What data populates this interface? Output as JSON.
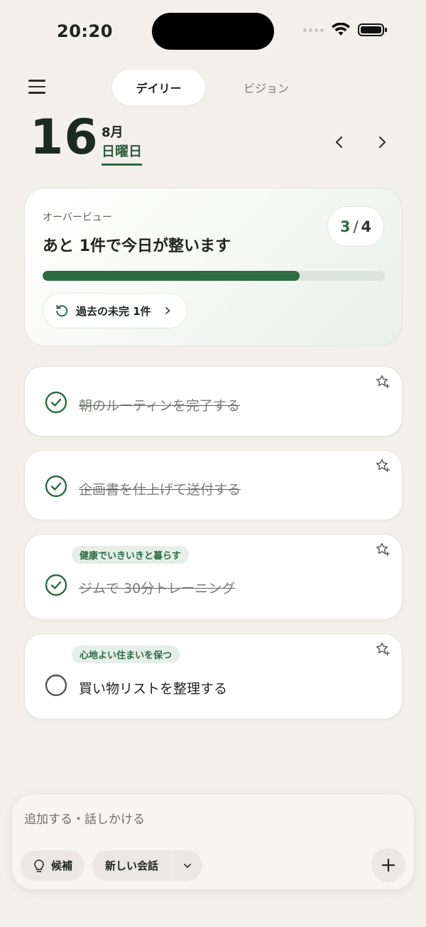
{
  "status_bar": {
    "time": "20:20"
  },
  "tabs": [
    {
      "label": "デイリー",
      "active": true
    },
    {
      "label": "ビジョン",
      "active": false
    }
  ],
  "date": {
    "day": "16",
    "month": "8月",
    "weekday": "日曜日"
  },
  "overview": {
    "label": "オーバービュー",
    "title": "あと 1件で今日が整います",
    "done_count": "3",
    "separator": "/",
    "total_count": "4",
    "progress_fraction": 0.75,
    "past_incomplete_label": "過去の未完 1件"
  },
  "tasks": [
    {
      "title": "朝のルーティンを完了する",
      "done": true,
      "tag": ""
    },
    {
      "title": "企画書を仕上げて送付する",
      "done": true,
      "tag": ""
    },
    {
      "title": "ジムで 30分トレーニング",
      "done": true,
      "tag": "健康でいきいきと暮らす"
    },
    {
      "title": "買い物リストを整理する",
      "done": false,
      "tag": "心地よい住まいを保つ"
    }
  ],
  "composer": {
    "placeholder": "追加する・話しかける",
    "suggest_label": "候補",
    "new_chat_label": "新しい会話"
  },
  "colors": {
    "accent": "#2e6b43",
    "background": "#f3f0eb",
    "tag_bg": "#e5efe7"
  },
  "icons": [
    "menu-icon",
    "chevron-left-icon",
    "chevron-right-icon",
    "refresh-icon",
    "star-plus-icon",
    "check-circle-icon",
    "empty-circle-icon",
    "lightbulb-icon",
    "chevron-down-icon",
    "plus-icon"
  ]
}
